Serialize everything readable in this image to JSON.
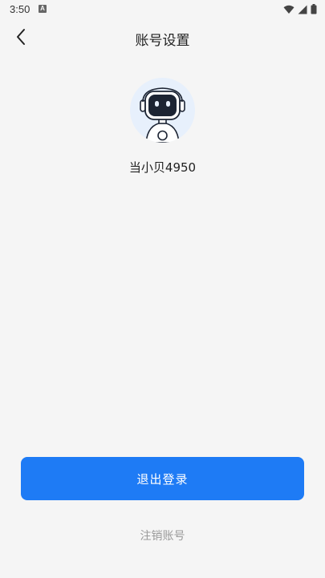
{
  "status_bar": {
    "time": "3:50",
    "notification_badge": "A",
    "icons": [
      "wifi-icon",
      "signal-icon",
      "battery-icon"
    ]
  },
  "header": {
    "title": "账号设置",
    "back_icon": "chevron-left-icon"
  },
  "profile": {
    "avatar_icon": "robot-avatar-icon",
    "username": "当小贝4950"
  },
  "actions": {
    "logout_label": "退出登录",
    "cancel_account_label": "注销账号"
  },
  "colors": {
    "background": "#f5f5f5",
    "primary": "#1e7bf5",
    "avatar_bg": "#e7f0fc",
    "muted_text": "#9a9a9a"
  }
}
